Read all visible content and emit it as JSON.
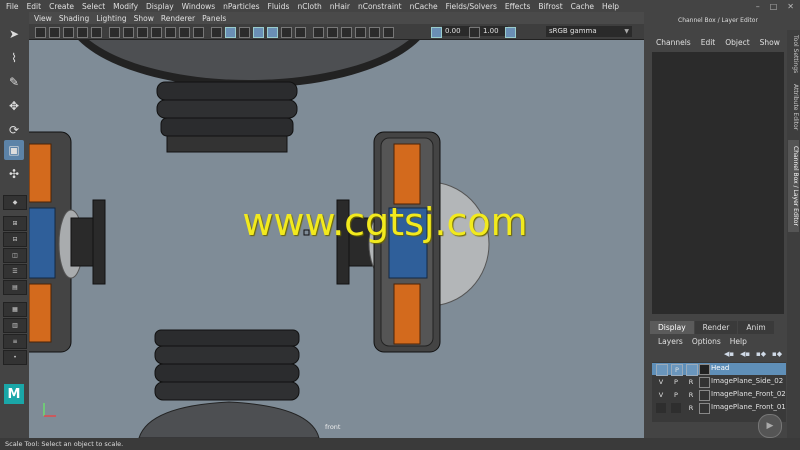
{
  "menubar": {
    "items": [
      "File",
      "Edit",
      "Create",
      "Select",
      "Modify",
      "Display",
      "Windows",
      "nParticles",
      "Fluids",
      "nCloth",
      "nHair",
      "nConstraint",
      "nCache",
      "Fields/Solvers",
      "Effects",
      "Bifrost",
      "Cache",
      "Help"
    ]
  },
  "window_controls": {
    "minimize": "–",
    "maximize": "□",
    "close": "✕"
  },
  "panel_menu": {
    "items": [
      "View",
      "Shading",
      "Lighting",
      "Show",
      "Renderer",
      "Panels"
    ]
  },
  "panel_toolbar": {
    "exposure": "0.00",
    "gamma": "1.00",
    "color_space": "sRGB gamma"
  },
  "viewport": {
    "camera_label": "front",
    "watermark": "www.cgtsj.com"
  },
  "right_panel": {
    "title": "Channel Box / Layer Editor",
    "menu": [
      "Channels",
      "Edit",
      "Object",
      "Show"
    ],
    "tabs": [
      "Display",
      "Render",
      "Anim"
    ],
    "active_tab": "Display",
    "layer_menu": [
      "Layers",
      "Options",
      "Help"
    ],
    "layers": [
      {
        "v": "",
        "p": "P",
        "r": "",
        "name": "Head",
        "selected": true
      },
      {
        "v": "V",
        "p": "P",
        "r": "R",
        "name": "ImagePlane_Side_02",
        "selected": false
      },
      {
        "v": "V",
        "p": "P",
        "r": "R",
        "name": "ImagePlane_Front_02",
        "selected": false
      },
      {
        "v": "",
        "p": "",
        "r": "R",
        "name": "ImagePlane_Front_01",
        "selected": false
      }
    ],
    "vertical_tabs": [
      "Tool Settings",
      "Attribute Editor",
      "Channel Box / Layer Editor"
    ]
  },
  "help_line": "Scale Tool: Select an object to scale.",
  "colors": {
    "accent": "#5c83a8",
    "watermark": "#f2ea1e",
    "orange": "#d36a1d",
    "blue": "#2f5f9a",
    "viewport_bg": "#7f8c97"
  }
}
